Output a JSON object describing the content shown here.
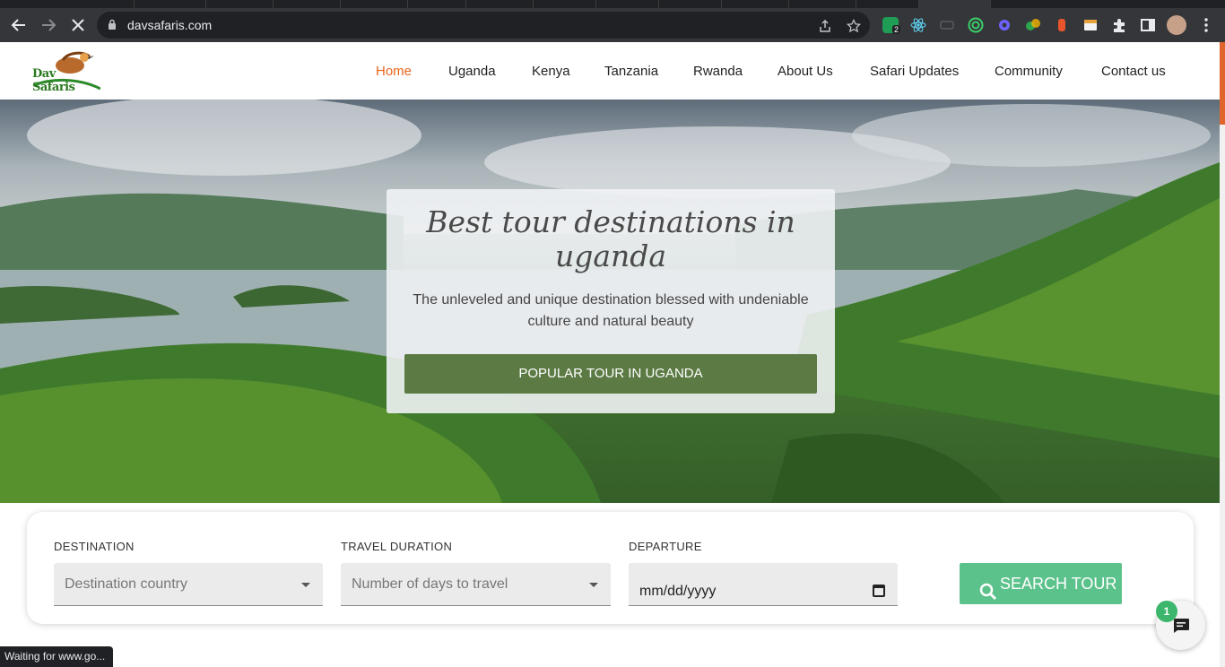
{
  "browser": {
    "url": "davsafaris.com",
    "status_text": "Waiting for www.go...",
    "profile_badge": "2"
  },
  "site": {
    "logo_text": "Dav Safaris",
    "nav": [
      {
        "label": "Home",
        "active": true
      },
      {
        "label": "Uganda"
      },
      {
        "label": "Kenya"
      },
      {
        "label": "Tanzania"
      },
      {
        "label": "Rwanda"
      },
      {
        "label": "About Us"
      },
      {
        "label": "Safari Updates"
      },
      {
        "label": "Community"
      },
      {
        "label": "Contact us"
      }
    ],
    "accent": "#e8641c"
  },
  "hero": {
    "title": "Best tour destinations in uganda",
    "subtitle": "The unleveled and unique destination blessed with undeniable culture and natural beauty",
    "cta": "POPULAR TOUR IN UGANDA",
    "cta_color": "#5b7a44"
  },
  "search": {
    "destination_label": "DESTINATION",
    "destination_placeholder": "Destination country",
    "duration_label": "TRAVEL DURATION",
    "duration_placeholder": "Number of days to travel",
    "departure_label": "DEPARTURE",
    "departure_value": "mm/dd/yyyy",
    "button": "SEARCH TOUR",
    "button_color": "#5cc28b"
  },
  "chat": {
    "unread": "1"
  }
}
